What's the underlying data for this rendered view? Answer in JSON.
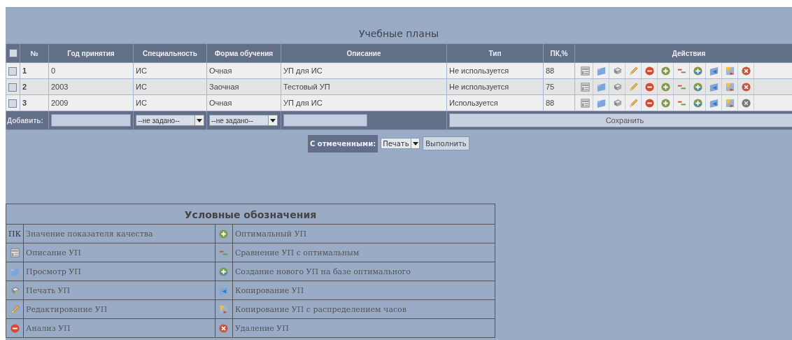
{
  "title": "Учебные планы",
  "table": {
    "select_all": {
      "checked": false
    },
    "columns": [
      "№",
      "Год принятия",
      "Специальность",
      "Форма обучения",
      "Описание",
      "Тип",
      "ПК,%",
      "Действия"
    ],
    "rows": [
      {
        "checked": false,
        "number": "1",
        "year": "0",
        "specialty": "ИС",
        "form": "Очная",
        "description": "УП для ИС",
        "type": "Не используется",
        "quality": "88",
        "can_delete": true
      },
      {
        "checked": false,
        "number": "2",
        "year": "2003",
        "specialty": "ИС",
        "form": "Заочная",
        "description": "Тестовый УП",
        "type": "Не используется",
        "quality": "75",
        "can_delete": true
      },
      {
        "checked": false,
        "number": "3",
        "year": "2009",
        "specialty": "ИС",
        "form": "Очная",
        "description": "УП для ИС",
        "type": "Используется",
        "quality": "88",
        "can_delete": false
      }
    ],
    "add_row": {
      "label": "Добавить:",
      "specialty": "--не задано--",
      "form": "--не задано--",
      "save": "Сохранить"
    }
  },
  "bulk": {
    "label": "С отмеченными:",
    "action": "Печать",
    "run": "Выполнить"
  },
  "legend": {
    "title": "Условные обозначения",
    "left": [
      {
        "kind": "text",
        "symbol": "ПК",
        "label": "Значение показателя качества"
      },
      {
        "kind": "description",
        "label": "Описание УП"
      },
      {
        "kind": "view",
        "label": "Просмотр УП"
      },
      {
        "kind": "print",
        "label": "Печать УП"
      },
      {
        "kind": "edit",
        "label": "Редактирование УП"
      },
      {
        "kind": "analysis",
        "label": "Анализ УП"
      }
    ],
    "right": [
      {
        "kind": "optimal",
        "label": "Оптимальный УП"
      },
      {
        "kind": "compare",
        "label": "Сравнение УП с оптимальным"
      },
      {
        "kind": "create",
        "label": "Создание нового УП на базе оптимального"
      },
      {
        "kind": "copy",
        "label": "Копирование УП"
      },
      {
        "kind": "copy_hours",
        "label": "Копирование УП с распределением часов"
      },
      {
        "kind": "delete",
        "label": "Удаление УП"
      }
    ]
  }
}
